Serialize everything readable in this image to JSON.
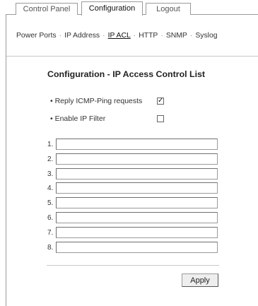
{
  "tabs": {
    "control_panel": "Control Panel",
    "configuration": "Configuration",
    "logout": "Logout"
  },
  "nav": {
    "items": [
      "Power Ports",
      "IP Address",
      "IP ACL",
      "HTTP",
      "SNMP",
      "Syslog"
    ],
    "separator": "·",
    "current": "IP ACL"
  },
  "page_title": "Configuration - IP Access Control List",
  "options": {
    "reply_icmp_label": "• Reply ICMP-Ping requests",
    "reply_icmp_checked": true,
    "enable_filter_label": "• Enable IP Filter",
    "enable_filter_checked": false,
    "check_glyph": "✓"
  },
  "acl_rows": [
    {
      "label": "1.",
      "value": ""
    },
    {
      "label": "2.",
      "value": ""
    },
    {
      "label": "3.",
      "value": ""
    },
    {
      "label": "4.",
      "value": ""
    },
    {
      "label": "5.",
      "value": ""
    },
    {
      "label": "6.",
      "value": ""
    },
    {
      "label": "7.",
      "value": ""
    },
    {
      "label": "8.",
      "value": ""
    }
  ],
  "apply_label": "Apply"
}
